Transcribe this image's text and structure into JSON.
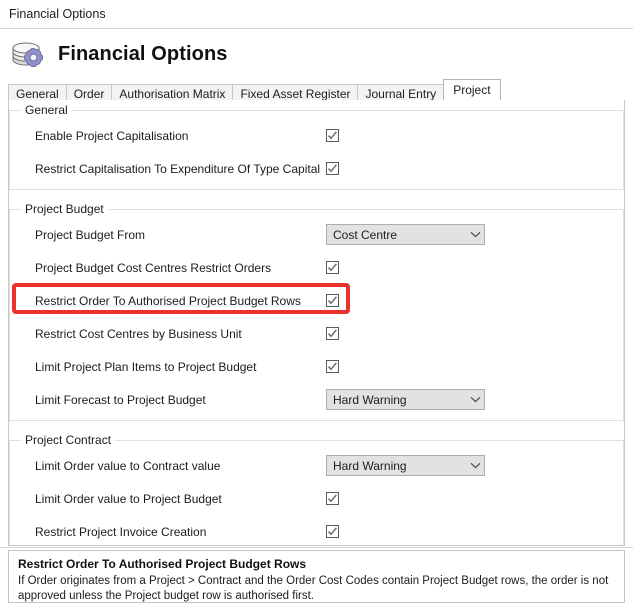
{
  "window": {
    "title": "Financial Options"
  },
  "header": {
    "title": "Financial Options",
    "icon": "coins-gear-icon"
  },
  "tabs": [
    {
      "label": "General",
      "selected": false
    },
    {
      "label": "Order",
      "selected": false
    },
    {
      "label": "Authorisation Matrix",
      "selected": false
    },
    {
      "label": "Fixed Asset Register",
      "selected": false
    },
    {
      "label": "Journal Entry",
      "selected": false
    },
    {
      "label": "Project",
      "selected": true
    }
  ],
  "groups": [
    {
      "legend": "General",
      "rows": [
        {
          "label": "Enable Project Capitalisation",
          "control": "checkbox",
          "checked": true
        },
        {
          "label": "Restrict Capitalisation To Expenditure Of Type Capital",
          "control": "checkbox",
          "checked": true
        }
      ]
    },
    {
      "legend": "Project Budget",
      "rows": [
        {
          "label": "Project Budget From",
          "control": "dropdown",
          "value": "Cost Centre"
        },
        {
          "label": "Project Budget Cost Centres Restrict Orders",
          "control": "checkbox",
          "checked": true
        },
        {
          "label": "Restrict Order To Authorised Project Budget Rows",
          "control": "checkbox",
          "checked": true,
          "highlighted": true
        },
        {
          "label": "Restrict Cost Centres by Business Unit",
          "control": "checkbox",
          "checked": true
        },
        {
          "label": "Limit Project Plan Items to Project Budget",
          "control": "checkbox",
          "checked": true
        },
        {
          "label": "Limit Forecast to Project Budget",
          "control": "dropdown",
          "value": "Hard Warning"
        }
      ]
    },
    {
      "legend": "Project Contract",
      "rows": [
        {
          "label": "Limit Order value to Contract value",
          "control": "dropdown",
          "value": "Hard Warning"
        },
        {
          "label": "Limit Order value to Project Budget",
          "control": "checkbox",
          "checked": true
        },
        {
          "label": "Restrict Project Invoice Creation",
          "control": "checkbox",
          "checked": true
        }
      ]
    }
  ],
  "help": {
    "title": "Restrict Order To Authorised Project Budget Rows",
    "body": "If Order originates from a Project > Contract and the Order Cost Codes contain Project Budget rows, the order is not approved unless the Project budget row is authorised first."
  },
  "colors": {
    "highlight": "#e8322a",
    "dropdown_bg": "#e2e2e2",
    "group_border": "#dfdfdf",
    "gear": "#8e8cc4"
  }
}
